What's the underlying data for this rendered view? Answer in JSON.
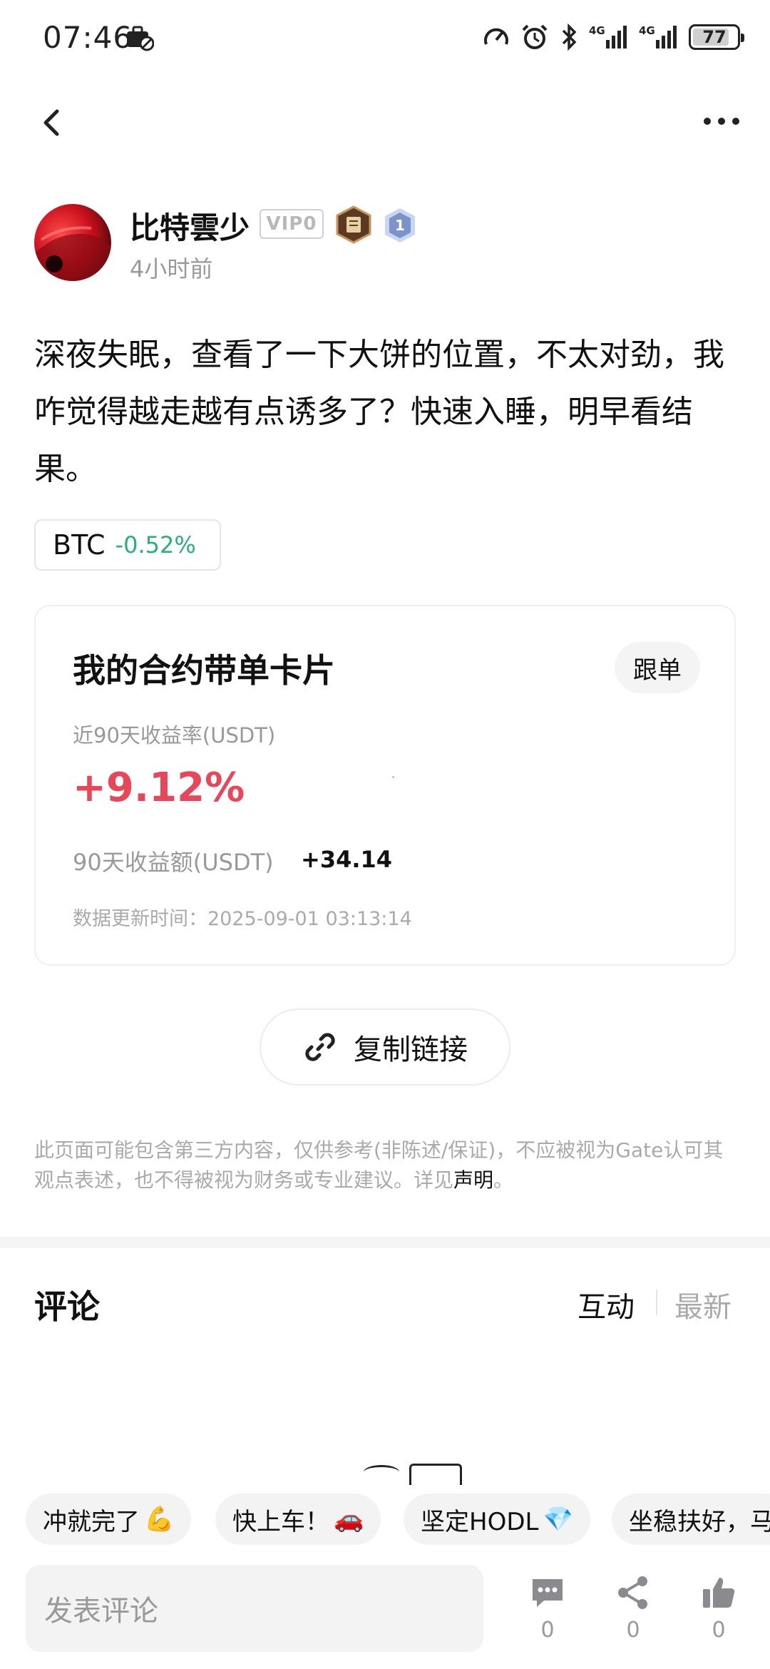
{
  "status_bar": {
    "time": "07:46",
    "battery": "77",
    "network_1": "4G",
    "network_2": "4G"
  },
  "nav": {
    "back_icon": "chevron-left-icon",
    "more_icon": "more-horizontal-icon"
  },
  "author": {
    "name": "比特雲少",
    "vip": "VIP0",
    "level": "1",
    "posted": "4小时前"
  },
  "post": {
    "text": "深夜失眠，查看了一下大饼的位置，不太对劲，我咋觉得越走越有点诱多了？快速入睡，明早看结果。"
  },
  "coin_tag": {
    "symbol": "BTC",
    "change": "-0.52%",
    "change_color": "#27b17a"
  },
  "card": {
    "title": "我的合约带单卡片",
    "follow_label": "跟单",
    "rate_label": "近90天收益率(USDT)",
    "rate_value": "+9.12%",
    "rate_color": "#e8475a",
    "amount_label": "90天收益额(USDT)",
    "amount_value": "+34.14",
    "updated_label": "数据更新时间：",
    "updated_value": "2025-09-01 03:13:14"
  },
  "copy_link": {
    "label": "复制链接",
    "icon": "link-icon"
  },
  "disclaimer": {
    "text": "此页面可能包含第三方内容，仅供参考(非陈述/保证)，不应被视为Gate认可其观点表述，也不得被视为财务或专业建议。详见",
    "link": "声明",
    "end": "。"
  },
  "comments": {
    "title": "评论",
    "sort_hot": "互动",
    "sort_new": "最新"
  },
  "quick_replies": [
    {
      "text": "冲就完了",
      "emoji": "💪"
    },
    {
      "text": "快上车！",
      "emoji": "🚗"
    },
    {
      "text": "坚定HODL",
      "emoji": "💎"
    },
    {
      "text": "坐稳扶好，马",
      "emoji": ""
    }
  ],
  "bottom_bar": {
    "input_placeholder": "发表评论",
    "comment_count": "0",
    "share_count": "0",
    "like_count": "0"
  }
}
